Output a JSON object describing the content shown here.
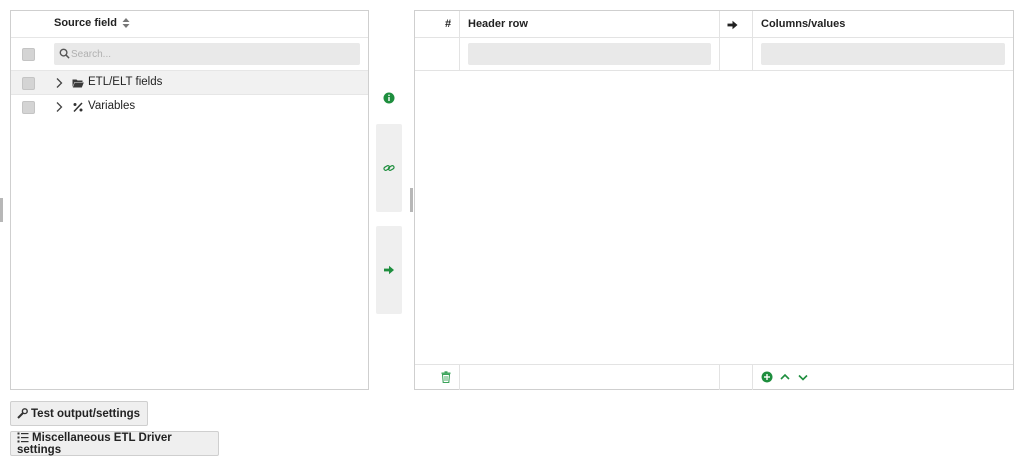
{
  "left_panel": {
    "header": {
      "title": "Source field"
    },
    "search": {
      "placeholder": "Search..."
    },
    "tree": [
      {
        "label": "ETL/ELT fields",
        "icon": "folder-open-icon",
        "selected": true
      },
      {
        "label": "Variables",
        "icon": "percent-icon",
        "selected": false
      }
    ]
  },
  "right_panel": {
    "header": {
      "index": "#",
      "header_row": "Header row",
      "arrow_icon": "arrow-right-icon",
      "columns_values": "Columns/values"
    },
    "row": {
      "header_value": "",
      "column_value": ""
    },
    "footer": {
      "icons": [
        "trash-icon",
        "add-circle-icon",
        "chevron-up-icon",
        "chevron-down-icon"
      ]
    }
  },
  "middle": {
    "icons": [
      "info-icon",
      "link-icon",
      "arrow-right-icon"
    ]
  },
  "buttons": {
    "test_output": "Test output/settings",
    "misc_settings": "Miscellaneous ETL Driver settings"
  },
  "colors": {
    "accent_green": "#1e8e3e",
    "panel_border": "#cfcfcf",
    "input_bg": "#e9e9e9"
  }
}
